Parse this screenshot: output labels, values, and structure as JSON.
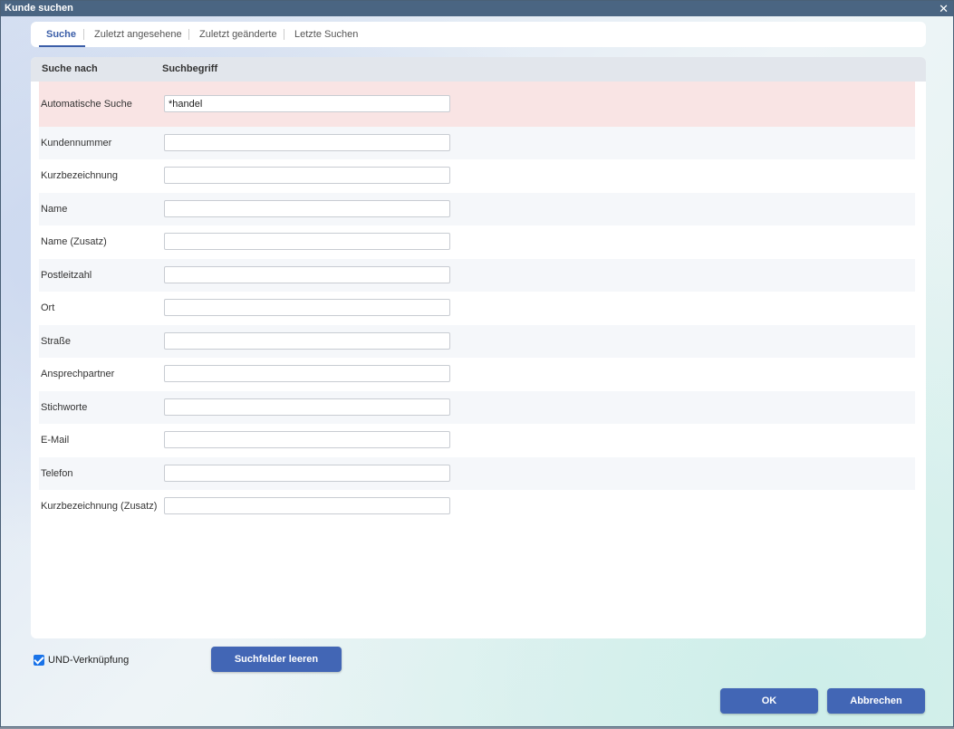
{
  "window": {
    "title": "Kunde suchen",
    "close_label": "✕"
  },
  "tabs": [
    {
      "label": "Suche",
      "active": true
    },
    {
      "label": "Zuletzt angesehene",
      "active": false
    },
    {
      "label": "Zuletzt geänderte",
      "active": false
    },
    {
      "label": "Letzte Suchen",
      "active": false
    }
  ],
  "table": {
    "headers": {
      "search_by": "Suche nach",
      "search_term": "Suchbegriff"
    },
    "rows": [
      {
        "label": "Automatische Suche",
        "value": "*handel"
      },
      {
        "label": "Kundennummer",
        "value": ""
      },
      {
        "label": "Kurzbezeichnung",
        "value": ""
      },
      {
        "label": "Name",
        "value": ""
      },
      {
        "label": "Name (Zusatz)",
        "value": ""
      },
      {
        "label": "Postleitzahl",
        "value": ""
      },
      {
        "label": "Ort",
        "value": ""
      },
      {
        "label": "Straße",
        "value": ""
      },
      {
        "label": "Ansprechpartner",
        "value": ""
      },
      {
        "label": "Stichworte",
        "value": ""
      },
      {
        "label": "E-Mail",
        "value": ""
      },
      {
        "label": "Telefon",
        "value": ""
      },
      {
        "label": "Kurzbezeichnung (Zusatz)",
        "value": ""
      }
    ]
  },
  "footer": {
    "and_link_label": "UND-Verknüpfung",
    "and_link_checked": true,
    "clear_button": "Suchfelder leeren",
    "ok_button": "OK",
    "cancel_button": "Abbrechen"
  },
  "colors": {
    "accent": "#4266b5",
    "highlight_row": "#f9e4e4",
    "titlebar": "#4a6582"
  }
}
